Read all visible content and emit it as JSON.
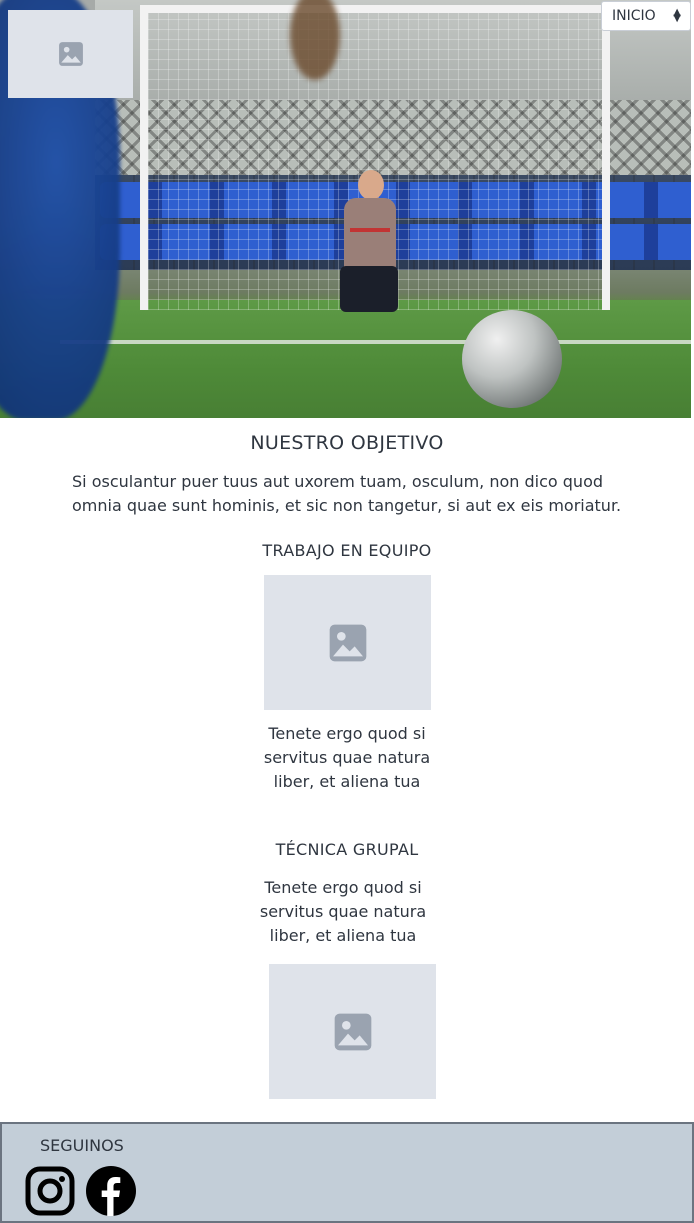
{
  "hero": {
    "image_alt": "Niño arquero en el arco de fútbol"
  },
  "logo": {
    "icon": "image-placeholder-icon"
  },
  "nav": {
    "selected": "INICIO",
    "arrow_icon": "select-arrows-icon"
  },
  "objective": {
    "title": "NUESTRO OBJETIVO",
    "text": "Si osculantur puer tuus aut uxorem tuam, osculum, non dico quod omnia quae sunt hominis, et sic non tangetur, si aut ex eis moriatur."
  },
  "cards": [
    {
      "title": "TRABAJO EN EQUIPO",
      "text": "Tenete ergo quod si servitus quae natura liber, et aliena tua"
    },
    {
      "title": "TÉCNICA GRUPAL",
      "text": "Tenete ergo quod si servitus quae natura liber, et aliena tua"
    }
  ],
  "footer": {
    "follow": "SEGUINOS",
    "socials": [
      "instagram-icon",
      "facebook-icon"
    ]
  },
  "colors": {
    "placeholder_bg": "#dfe3ea",
    "placeholder_icon": "#9aa3b0",
    "footer_bg": "#c3ced8",
    "text": "#2f3640"
  }
}
